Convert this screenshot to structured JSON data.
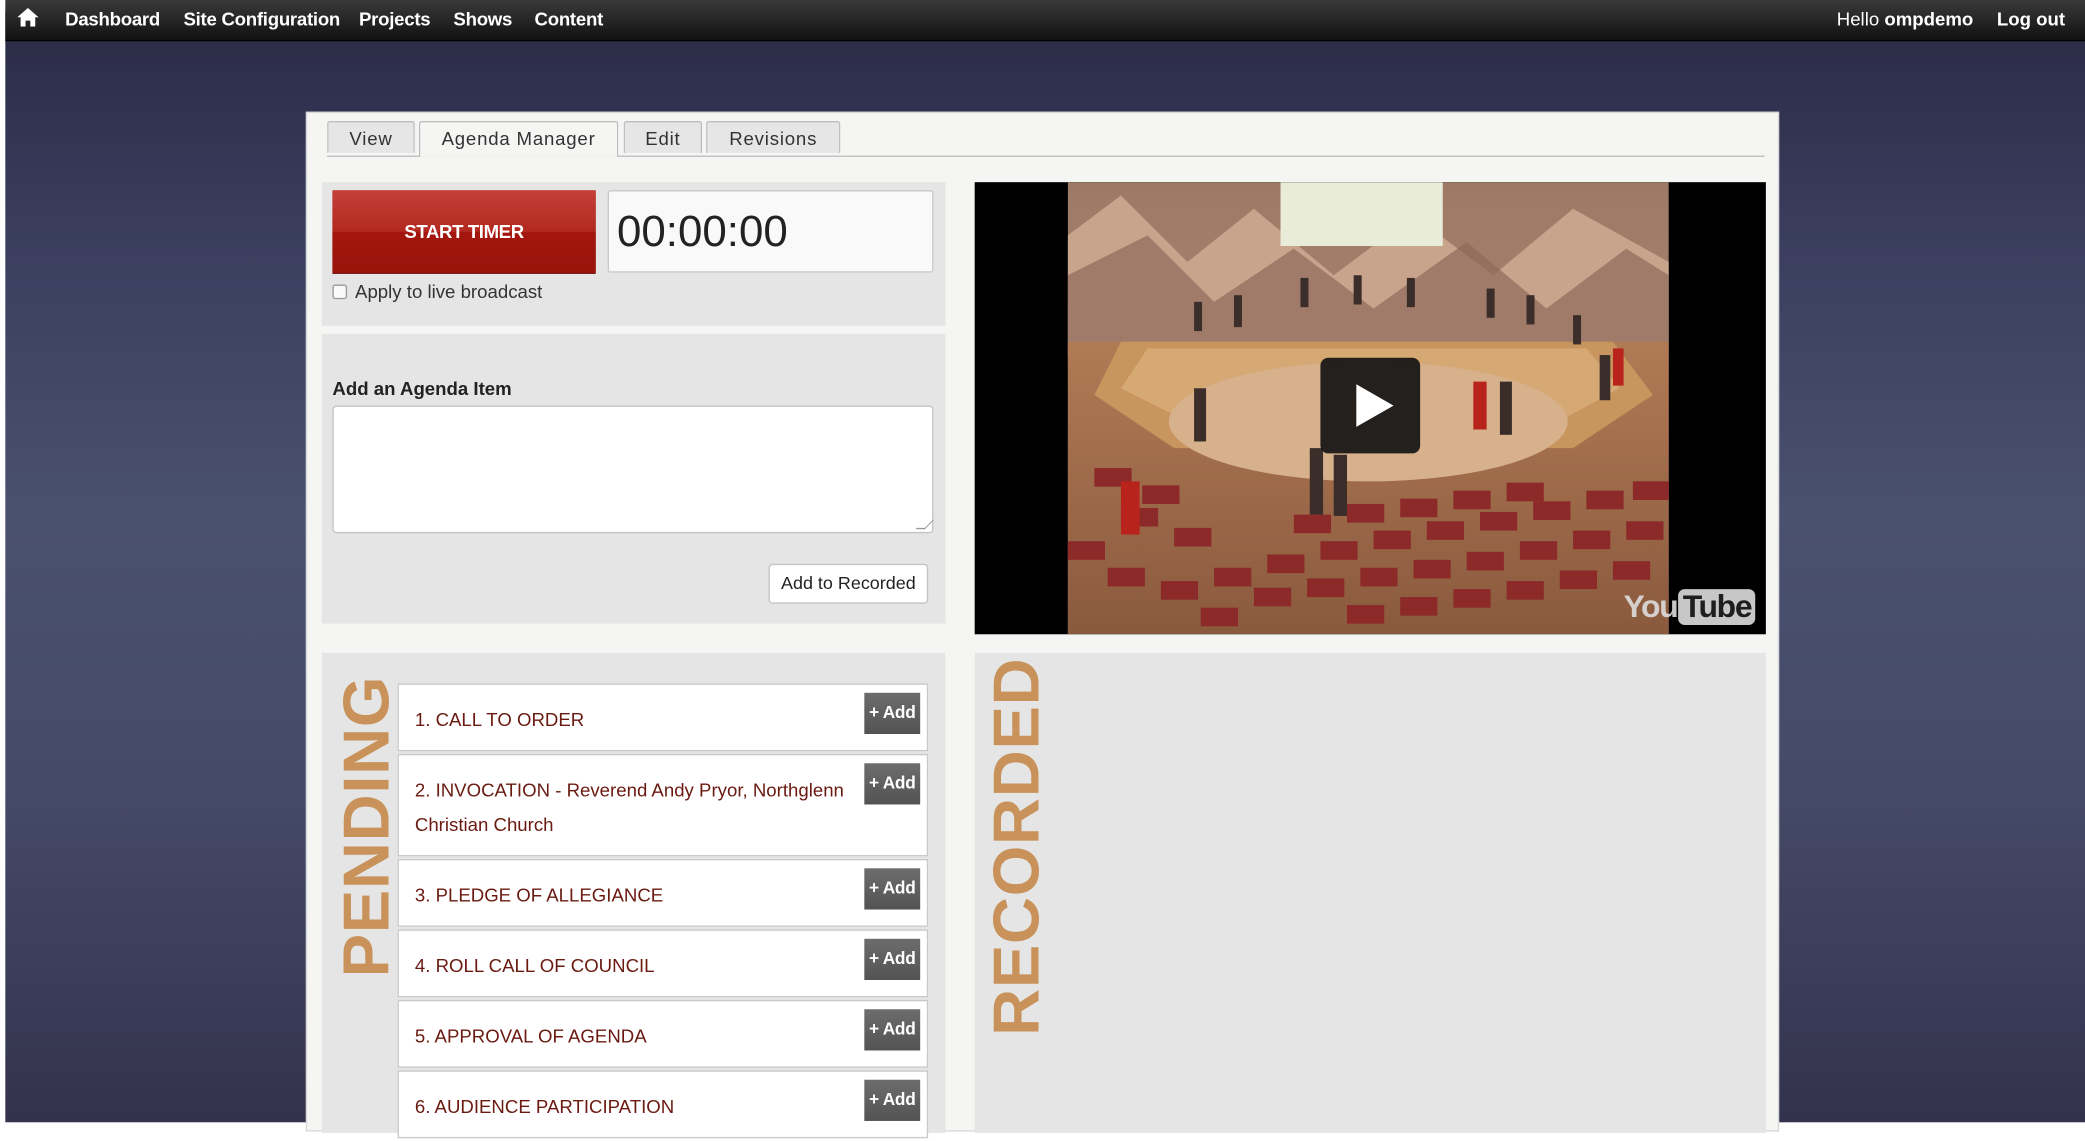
{
  "topbar": {
    "nav": [
      "Dashboard",
      "Site Configuration",
      "Projects",
      "Shows",
      "Content"
    ],
    "greeting": "Hello",
    "username": "ompdemo",
    "logout": "Log out"
  },
  "tabs": [
    "View",
    "Agenda Manager",
    "Edit",
    "Revisions"
  ],
  "active_tab": "Agenda Manager",
  "timer": {
    "start_label": "START TIMER",
    "display": "00:00:00",
    "apply_live_label": "Apply to live broadcast",
    "apply_live_checked": false
  },
  "agenda_form": {
    "label": "Add an Agenda Item",
    "textarea_value": "",
    "add_button": "Add to Recorded"
  },
  "video": {
    "logo_you": "You",
    "logo_tube": "Tube"
  },
  "pending": {
    "title": "PENDING",
    "add_label": "+ Add",
    "items": [
      "1. CALL TO ORDER",
      "2. INVOCATION - Reverend Andy Pryor, Northglenn Christian Church",
      "3. PLEDGE OF ALLEGIANCE",
      "4. ROLL CALL OF COUNCIL",
      "5. APPROVAL OF AGENDA",
      "6. AUDIENCE PARTICIPATION"
    ]
  },
  "recorded": {
    "title": "RECORDED",
    "items": []
  },
  "colors": {
    "start_button": "#b3291f",
    "section_label": "#c8925a",
    "agenda_text": "#6a1a10",
    "add_button": "#5e5e5e"
  }
}
